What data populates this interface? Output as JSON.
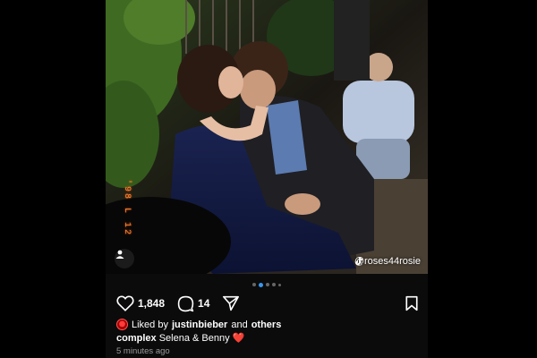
{
  "post": {
    "photo_stamp": "'98 L 12",
    "credit_handle": "@roses44rosie",
    "carousel": {
      "count": 5,
      "active_index": 1
    },
    "likes_count": "1,848",
    "comments_count": "14",
    "liked_by": {
      "prefix": "Liked by",
      "user": "justinbieber",
      "joiner": "and",
      "suffix": "others"
    },
    "caption": {
      "username": "complex",
      "text": "Selena & Benny",
      "emoji": "❤️"
    },
    "timestamp": "5 minutes ago"
  },
  "colors": {
    "background": "#000000",
    "accent_blue": "#3897f0",
    "date_stamp": "#ff8a3a"
  }
}
